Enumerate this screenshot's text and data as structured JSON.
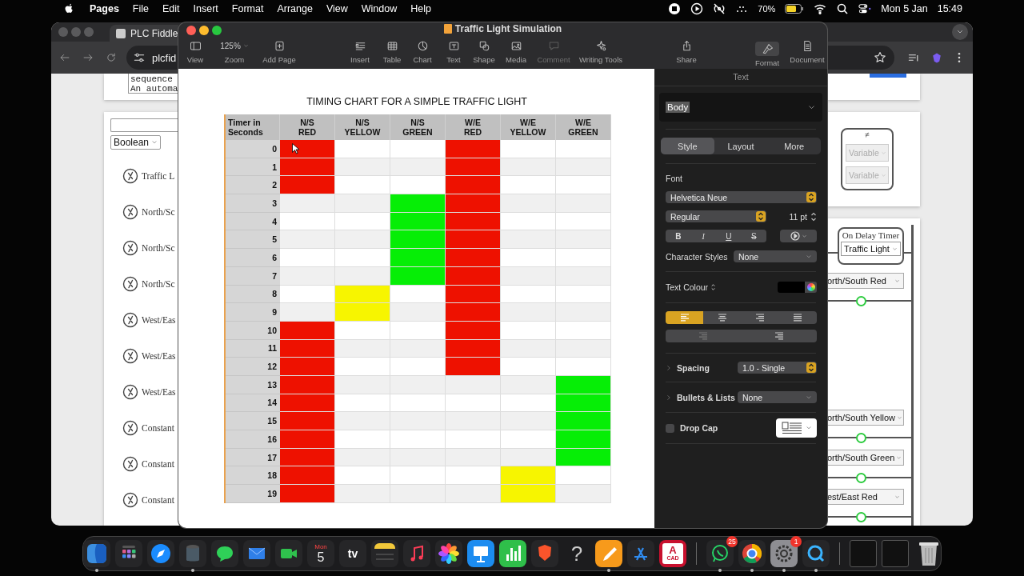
{
  "menu_bar": {
    "app_name": "Pages",
    "menus": [
      "File",
      "Edit",
      "Insert",
      "Format",
      "Arrange",
      "View",
      "Window",
      "Help"
    ],
    "battery": "70%",
    "date": "Mon 5 Jan",
    "time": "15:49"
  },
  "browser": {
    "tab_title": "PLC Fiddle",
    "address": "plcfid",
    "code_lines": [
      "sequence",
      "An automa"
    ],
    "type_select": "Boolean",
    "variables": [
      "Traffic L",
      "North/Sc",
      "North/Sc",
      "North/Sc",
      "West/Eas",
      "West/Eas",
      "West/Eas",
      "Constant",
      "Constant",
      "Constant"
    ],
    "compare": {
      "symbol": "≠",
      "inputs": [
        "Variable",
        "Variable"
      ]
    },
    "timer": {
      "title": "On Delay Timer",
      "variable": "Traffic Light"
    },
    "contacts": [
      "orth/South Red",
      "orth/South Yellow",
      "orth/South Green",
      "est/East Red"
    ]
  },
  "pages": {
    "title": "Traffic Light Simulation",
    "toolbar": [
      {
        "kind": "view",
        "label": "View",
        "selected": false,
        "disabled": false
      },
      {
        "kind": "zoom",
        "label": "Zoom",
        "value": "125%",
        "selected": false,
        "disabled": false
      },
      {
        "kind": "add-page",
        "label": "Add Page",
        "selected": false,
        "disabled": false
      },
      {
        "kind": "insert",
        "label": "Insert",
        "selected": false,
        "disabled": false
      },
      {
        "kind": "table",
        "label": "Table",
        "selected": false,
        "disabled": false
      },
      {
        "kind": "chart",
        "label": "Chart",
        "selected": false,
        "disabled": false
      },
      {
        "kind": "text",
        "label": "Text",
        "selected": false,
        "disabled": false
      },
      {
        "kind": "shape",
        "label": "Shape",
        "selected": false,
        "disabled": false
      },
      {
        "kind": "media",
        "label": "Media",
        "selected": false,
        "disabled": false
      },
      {
        "kind": "comment",
        "label": "Comment",
        "selected": false,
        "disabled": true
      },
      {
        "kind": "writing-tools",
        "label": "Writing Tools",
        "selected": false,
        "disabled": false
      },
      {
        "kind": "share",
        "label": "Share",
        "selected": false,
        "disabled": false
      },
      {
        "kind": "format",
        "label": "Format",
        "selected": true,
        "disabled": false
      },
      {
        "kind": "document",
        "label": "Document",
        "selected": false,
        "disabled": false
      }
    ],
    "heading": "TIMING CHART FOR A SIMPLE TRAFFIC LIGHT",
    "table": {
      "columns": [
        {
          "label": "Timer in\nSeconds"
        },
        {
          "label": "N/S\nRED",
          "color": "#ee1100"
        },
        {
          "label": "N/S\nYELLOW",
          "color": "#f7f500"
        },
        {
          "label": "N/S\nGREEN",
          "color": "#06ee06"
        },
        {
          "label": "W/E\nRED",
          "color": "#ee1100"
        },
        {
          "label": "W/E\nYELLOW",
          "color": "#f7f500"
        },
        {
          "label": "W/E\nGREEN",
          "color": "#06ee06"
        }
      ],
      "rows": [
        {
          "time": "0",
          "on": [
            true,
            false,
            false,
            true,
            false,
            false
          ]
        },
        {
          "time": "1",
          "on": [
            true,
            false,
            false,
            true,
            false,
            false
          ]
        },
        {
          "time": "2",
          "on": [
            true,
            false,
            false,
            true,
            false,
            false
          ]
        },
        {
          "time": "3",
          "on": [
            false,
            false,
            true,
            true,
            false,
            false
          ]
        },
        {
          "time": "4",
          "on": [
            false,
            false,
            true,
            true,
            false,
            false
          ]
        },
        {
          "time": "5",
          "on": [
            false,
            false,
            true,
            true,
            false,
            false
          ]
        },
        {
          "time": "6",
          "on": [
            false,
            false,
            true,
            true,
            false,
            false
          ]
        },
        {
          "time": "7",
          "on": [
            false,
            false,
            true,
            true,
            false,
            false
          ]
        },
        {
          "time": "8",
          "on": [
            false,
            true,
            false,
            true,
            false,
            false
          ]
        },
        {
          "time": "9",
          "on": [
            false,
            true,
            false,
            true,
            false,
            false
          ]
        },
        {
          "time": "10",
          "on": [
            true,
            false,
            false,
            true,
            false,
            false
          ]
        },
        {
          "time": "11",
          "on": [
            true,
            false,
            false,
            true,
            false,
            false
          ]
        },
        {
          "time": "12",
          "on": [
            true,
            false,
            false,
            true,
            false,
            false
          ]
        },
        {
          "time": "13",
          "on": [
            true,
            false,
            false,
            false,
            false,
            true
          ]
        },
        {
          "time": "14",
          "on": [
            true,
            false,
            false,
            false,
            false,
            true
          ]
        },
        {
          "time": "15",
          "on": [
            true,
            false,
            false,
            false,
            false,
            true
          ]
        },
        {
          "time": "16",
          "on": [
            true,
            false,
            false,
            false,
            false,
            true
          ]
        },
        {
          "time": "17",
          "on": [
            true,
            false,
            false,
            false,
            false,
            true
          ]
        },
        {
          "time": "18",
          "on": [
            true,
            false,
            false,
            false,
            true,
            false
          ]
        },
        {
          "time": "19",
          "on": [
            true,
            false,
            false,
            false,
            true,
            false
          ]
        }
      ]
    },
    "inspector": {
      "title": "Text",
      "paragraph_style": "Body",
      "tabs": [
        {
          "label": "Style",
          "selected": true
        },
        {
          "label": "Layout",
          "selected": false
        },
        {
          "label": "More",
          "selected": false
        }
      ],
      "font_label": "Font",
      "font_family": "Helvetica Neue",
      "font_style": "Regular",
      "font_size": "11 pt",
      "format_buttons": [
        {
          "kind": "bold",
          "label": "B"
        },
        {
          "kind": "italic",
          "label": "I"
        },
        {
          "kind": "underline",
          "label": "U"
        },
        {
          "kind": "strike",
          "label": "S"
        }
      ],
      "character_styles_label": "Character Styles",
      "character_style": "None",
      "text_colour_label": "Text Colour",
      "alignment": [
        {
          "kind": "left",
          "selected": true
        },
        {
          "kind": "center",
          "selected": false
        },
        {
          "kind": "right",
          "selected": false
        },
        {
          "kind": "justify",
          "selected": false
        }
      ],
      "spacing_label": "Spacing",
      "spacing": "1.0 - Single",
      "bullets_label": "Bullets & Lists",
      "bullets": "None",
      "drop_cap_label": "Drop Cap",
      "drop_cap": false
    }
  },
  "dock": {
    "apps": [
      {
        "kind": "finder",
        "running": true
      },
      {
        "kind": "launchpad",
        "running": false
      },
      {
        "kind": "safari",
        "running": false
      },
      {
        "kind": "cylinder",
        "running": true
      },
      {
        "kind": "messages",
        "running": false
      },
      {
        "kind": "mail",
        "running": false
      },
      {
        "kind": "facetime",
        "running": false
      },
      {
        "kind": "calendar",
        "month": "Mon",
        "day": "5",
        "running": false
      },
      {
        "kind": "tv",
        "label": "tv",
        "running": false
      },
      {
        "kind": "notes",
        "running": false
      },
      {
        "kind": "music",
        "running": false
      },
      {
        "kind": "photos",
        "running": false
      },
      {
        "kind": "keynote",
        "running": false
      },
      {
        "kind": "numbers",
        "running": false
      },
      {
        "kind": "brave",
        "running": false
      },
      {
        "kind": "help",
        "label": "?",
        "running": false
      },
      {
        "kind": "pages",
        "running": true
      },
      {
        "kind": "appstore",
        "running": false
      },
      {
        "kind": "cad",
        "label": "A",
        "sublabel": "CAD",
        "running": false
      }
    ],
    "recent": [
      {
        "kind": "whatsapp",
        "badge": "25",
        "running": true
      },
      {
        "kind": "chrome",
        "running": true
      },
      {
        "kind": "settings",
        "badge": "1",
        "running": true
      },
      {
        "kind": "quicktime",
        "running": true
      }
    ],
    "windows": [
      {
        "kind": "thumbnail"
      },
      {
        "kind": "thumbnail"
      }
    ]
  }
}
